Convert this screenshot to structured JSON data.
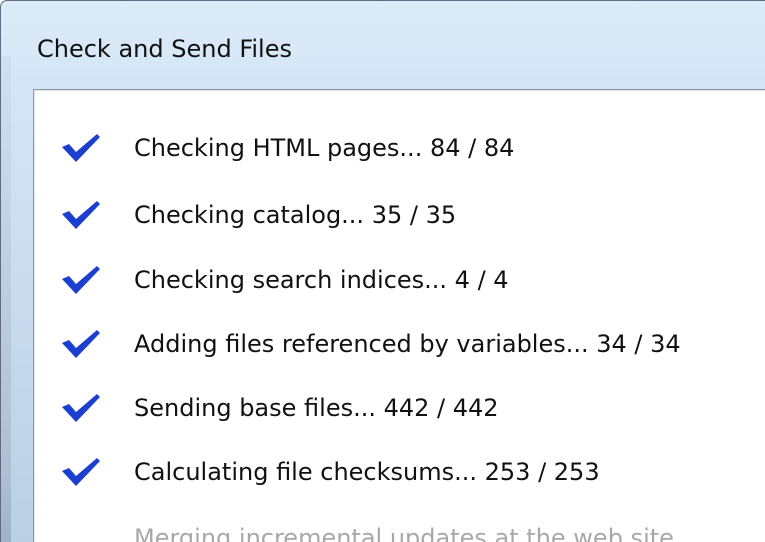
{
  "window": {
    "title": "Check and Send Files"
  },
  "steps": [
    {
      "label": "Checking HTML pages... 84 / 84",
      "status": "done",
      "icon": "checkmark-icon"
    },
    {
      "label": "Checking catalog... 35 / 35",
      "status": "done",
      "icon": "checkmark-icon"
    },
    {
      "label": "Checking search indices... 4 / 4",
      "status": "done",
      "icon": "checkmark-icon"
    },
    {
      "label": "Adding files referenced by variables... 34 / 34",
      "status": "done",
      "icon": "checkmark-icon"
    },
    {
      "label": "Sending base files... 442 / 442",
      "status": "done",
      "icon": "checkmark-icon"
    },
    {
      "label": "Calculating file checksums... 253 / 253",
      "status": "done",
      "icon": "checkmark-icon"
    },
    {
      "label": "Merging incremental updates at the web site...",
      "status": "pending"
    }
  ],
  "colors": {
    "checkmark": "#1c3fd0",
    "pending_text": "#a8a8a8",
    "title_bar": "#dcebf8"
  }
}
